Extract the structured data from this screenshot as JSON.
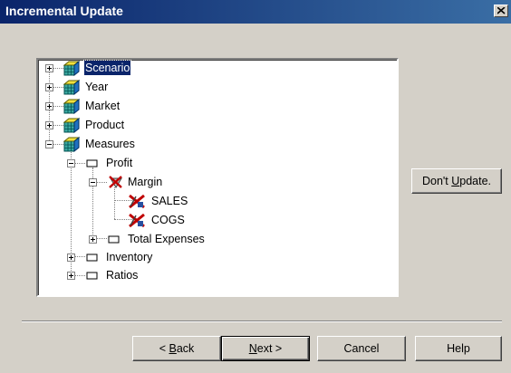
{
  "window": {
    "title": "Incremental Update"
  },
  "tree": {
    "items": [
      {
        "label": "Scenario",
        "selected": true
      },
      {
        "label": "Year"
      },
      {
        "label": "Market"
      },
      {
        "label": "Product"
      },
      {
        "label": "Measures"
      },
      {
        "label": "Profit"
      },
      {
        "label": "Margin"
      },
      {
        "label": "SALES"
      },
      {
        "label": "COGS"
      },
      {
        "label": "Total Expenses"
      },
      {
        "label": "Inventory"
      },
      {
        "label": "Ratios"
      }
    ]
  },
  "buttons": {
    "dont_update": {
      "pre": "Don't ",
      "hot": "U",
      "post": "pdate."
    },
    "back": {
      "pre": "< ",
      "hot": "B",
      "post": "ack"
    },
    "next": {
      "pre": "",
      "hot": "N",
      "post": "ext >"
    },
    "cancel": "Cancel",
    "help": "Help"
  },
  "colors": {
    "titlebar_start": "#0a246a",
    "titlebar_end": "#3a6ea5",
    "selection": "#0a246a",
    "dialog": "#d4d0c8"
  },
  "icons": {
    "dimension": "cube-dimension-icon",
    "member": "member-box-icon",
    "excluded": "excluded-member-icon",
    "close": "close-icon"
  }
}
